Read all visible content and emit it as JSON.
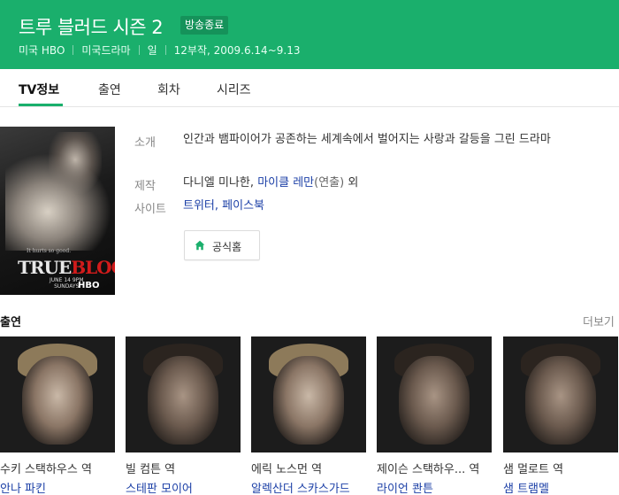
{
  "header": {
    "title": "트루 블러드 시즌 2",
    "badge": "방송종료",
    "meta": [
      "미국 HBO",
      "미국드라마",
      "일",
      "12부작, 2009.6.14~9.13"
    ],
    "bg_color": "#1aaf6c"
  },
  "tabs": [
    {
      "label": "TV정보",
      "active": true
    },
    {
      "label": "출연",
      "active": false
    },
    {
      "label": "회차",
      "active": false
    },
    {
      "label": "시리즈",
      "active": false
    }
  ],
  "poster": {
    "tagline": "It hurts so good.",
    "logo_a": "TRUE",
    "logo_b": "BLOOD",
    "date_line1": "JUNE 14 9PM",
    "date_line2": "SUNDAYS",
    "network": "HBO"
  },
  "info": {
    "intro_label": "소개",
    "intro_text": "인간과 뱀파이어가 공존하는 세계속에서 벌어지는 사랑과 갈등을 그린 드라마",
    "production_label": "제작",
    "production_person1": "다니엘 미나한",
    "production_sep": ",",
    "production_person2": "마이클 레만",
    "production_role": "(연출)",
    "production_etc": "외",
    "site_label": "사이트",
    "site_link1": "트위터",
    "site_sep": ",",
    "site_link2": "페이스북",
    "home_button": "공식홈",
    "home_icon": "home-icon"
  },
  "cast": {
    "title": "출연",
    "more": "더보기",
    "members": [
      {
        "role": "수키 스택하우스 역",
        "actor": "안나 파킨"
      },
      {
        "role": "빌 컴튼 역",
        "actor": "스테판 모이어"
      },
      {
        "role": "에릭 노스먼 역",
        "actor": "알렉산더 스카스가드"
      },
      {
        "role": "제이슨 스택하우... 역",
        "actor": "라이언 콴튼"
      },
      {
        "role": "샘 멀로트 역",
        "actor": "샘 트램멜"
      }
    ]
  }
}
